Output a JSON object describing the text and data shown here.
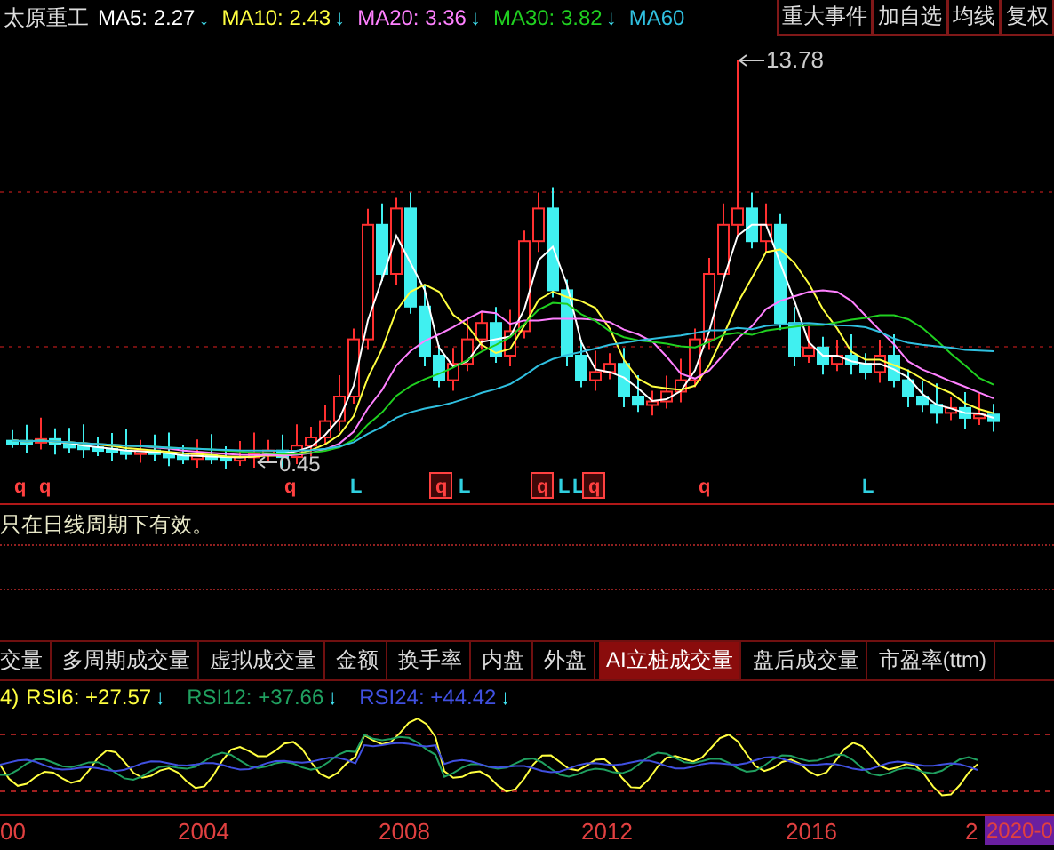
{
  "header": {
    "stock_name": "太原重工",
    "moving_averages": [
      {
        "label": "MA5: 2.27",
        "arrow": "↓",
        "color": "#ffffff"
      },
      {
        "label": "MA10: 2.43",
        "arrow": "↓",
        "color": "#ffff40"
      },
      {
        "label": "MA20: 3.36",
        "arrow": "↓",
        "color": "#ff80ff"
      },
      {
        "label": "MA30: 3.82",
        "arrow": "↓",
        "color": "#20d020"
      },
      {
        "label": "MA60",
        "color": "#30c0e0"
      }
    ],
    "buttons": [
      "重大事件",
      "加自选",
      "均线",
      "复权"
    ]
  },
  "price_chart": {
    "high_label": "13.78",
    "low_label": "0.45",
    "signals": [
      {
        "text": "q",
        "kind": "plain",
        "color": "#ff4040"
      },
      {
        "text": "q",
        "kind": "plain",
        "color": "#ff4040"
      },
      {
        "text": "q",
        "kind": "plain",
        "color": "#ff4040"
      },
      {
        "text": "L",
        "kind": "plain",
        "color": "#30d0e0"
      },
      {
        "text": "q",
        "kind": "boxed",
        "color": "#ff4040"
      },
      {
        "text": "L",
        "kind": "plain",
        "color": "#30d0e0"
      },
      {
        "text": "q",
        "kind": "boxed",
        "color": "#ff4040"
      },
      {
        "text": "L",
        "kind": "plain",
        "color": "#30d0e0"
      },
      {
        "text": "L",
        "kind": "plain",
        "color": "#30d0e0"
      },
      {
        "text": "q",
        "kind": "boxed",
        "color": "#ff4040"
      },
      {
        "text": "q",
        "kind": "plain",
        "color": "#ff4040"
      },
      {
        "text": "L",
        "kind": "plain",
        "color": "#30d0e0"
      }
    ]
  },
  "notice": "只在日线周期下有效。",
  "indicator_tabs": [
    {
      "label": "交量",
      "selected": false
    },
    {
      "label": "多周期成交量",
      "selected": false
    },
    {
      "label": "虚拟成交量",
      "selected": false
    },
    {
      "label": "金额",
      "selected": false
    },
    {
      "label": "换手率",
      "selected": false
    },
    {
      "label": "内盘",
      "selected": false
    },
    {
      "label": "外盘",
      "selected": false
    },
    {
      "label": "AI立桩成交量",
      "selected": true
    },
    {
      "label": "盘后成交量",
      "selected": false
    },
    {
      "label": "市盈率(ttm)",
      "selected": false
    }
  ],
  "rsi": {
    "prefix": "4)",
    "legend": [
      {
        "label": "RSI6: +27.57",
        "arrow": "↓",
        "color": "#ffff40"
      },
      {
        "label": "RSI12: +37.66",
        "arrow": "↓",
        "color": "#20a060"
      },
      {
        "label": "RSI24: +44.42",
        "arrow": "↓",
        "color": "#4050e0"
      }
    ]
  },
  "x_axis": {
    "labels": [
      "00",
      "2004",
      "2008",
      "2012",
      "2016",
      "2"
    ],
    "current_date": "2020-0"
  }
}
